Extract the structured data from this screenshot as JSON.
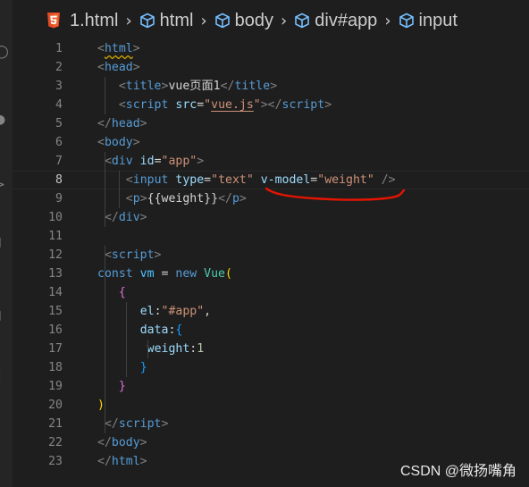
{
  "breadcrumb": {
    "file": "1.html",
    "items": [
      "html",
      "body",
      "div#app",
      "input"
    ]
  },
  "lines": [
    {
      "n": "1",
      "tokens": [
        [
          "bracket",
          "<"
        ],
        [
          "tag-squig",
          "html"
        ],
        [
          "bracket",
          ">"
        ]
      ]
    },
    {
      "n": "2",
      "tokens": [
        [
          "bracket",
          "<"
        ],
        [
          "tag",
          "head"
        ],
        [
          "bracket",
          ">"
        ]
      ]
    },
    {
      "n": "3",
      "tokens": [
        [
          "bracket",
          "<"
        ],
        [
          "tag",
          "title"
        ],
        [
          "bracket",
          ">"
        ],
        [
          "text",
          "vue页面1"
        ],
        [
          "bracket",
          "</"
        ],
        [
          "tag",
          "title"
        ],
        [
          "bracket",
          ">"
        ]
      ]
    },
    {
      "n": "4",
      "tokens": [
        [
          "bracket",
          "<"
        ],
        [
          "tag",
          "script"
        ],
        [
          "text",
          " "
        ],
        [
          "attr",
          "src"
        ],
        [
          "text",
          "="
        ],
        [
          "str",
          "\""
        ],
        [
          "str-ul",
          "vue.js"
        ],
        [
          "str",
          "\""
        ],
        [
          "bracket",
          "></"
        ],
        [
          "tag",
          "script"
        ],
        [
          "bracket",
          ">"
        ]
      ]
    },
    {
      "n": "5",
      "tokens": [
        [
          "bracket",
          "</"
        ],
        [
          "tag",
          "head"
        ],
        [
          "bracket",
          ">"
        ]
      ]
    },
    {
      "n": "6",
      "tokens": [
        [
          "bracket",
          "<"
        ],
        [
          "tag",
          "body"
        ],
        [
          "bracket",
          ">"
        ]
      ]
    },
    {
      "n": "7",
      "tokens": [
        [
          "bracket",
          "<"
        ],
        [
          "tag",
          "div"
        ],
        [
          "text",
          " "
        ],
        [
          "attr",
          "id"
        ],
        [
          "text",
          "="
        ],
        [
          "str",
          "\"app\""
        ],
        [
          "bracket",
          ">"
        ]
      ]
    },
    {
      "n": "8",
      "tokens": [
        [
          "bracket",
          "<"
        ],
        [
          "tag",
          "input"
        ],
        [
          "text",
          " "
        ],
        [
          "attr",
          "type"
        ],
        [
          "text",
          "="
        ],
        [
          "str",
          "\"text\""
        ],
        [
          "text",
          " "
        ],
        [
          "attr",
          "v-model"
        ],
        [
          "text",
          "="
        ],
        [
          "str",
          "\"weight\""
        ],
        [
          "text",
          " "
        ],
        [
          "bracket",
          "/>"
        ]
      ]
    },
    {
      "n": "9",
      "tokens": [
        [
          "bracket",
          "<"
        ],
        [
          "tag",
          "p"
        ],
        [
          "bracket",
          ">"
        ],
        [
          "text",
          "{{weight}}"
        ],
        [
          "bracket",
          "</"
        ],
        [
          "tag",
          "p"
        ],
        [
          "bracket",
          ">"
        ]
      ]
    },
    {
      "n": "10",
      "tokens": [
        [
          "bracket",
          "</"
        ],
        [
          "tag",
          "div"
        ],
        [
          "bracket",
          ">"
        ]
      ]
    },
    {
      "n": "11",
      "tokens": []
    },
    {
      "n": "12",
      "tokens": [
        [
          "bracket",
          "<"
        ],
        [
          "tag",
          "script"
        ],
        [
          "bracket",
          ">"
        ]
      ]
    },
    {
      "n": "13",
      "tokens": [
        [
          "kw",
          "const"
        ],
        [
          "text",
          " "
        ],
        [
          "var",
          "vm"
        ],
        [
          "text",
          " = "
        ],
        [
          "kw",
          "new"
        ],
        [
          "text",
          " "
        ],
        [
          "cls",
          "Vue"
        ],
        [
          "paren",
          "("
        ]
      ]
    },
    {
      "n": "14",
      "tokens": [
        [
          "brace2",
          "{"
        ]
      ]
    },
    {
      "n": "15",
      "tokens": [
        [
          "attr",
          "el"
        ],
        [
          "text",
          ":"
        ],
        [
          "str",
          "\"#app\""
        ],
        [
          "text",
          ","
        ]
      ]
    },
    {
      "n": "16",
      "tokens": [
        [
          "attr",
          "data"
        ],
        [
          "text",
          ":"
        ],
        [
          "brace3",
          "{"
        ]
      ]
    },
    {
      "n": "17",
      "tokens": [
        [
          "attr",
          "weight"
        ],
        [
          "text",
          ":"
        ],
        [
          "num",
          "1"
        ]
      ]
    },
    {
      "n": "18",
      "tokens": [
        [
          "brace3",
          "}"
        ]
      ]
    },
    {
      "n": "19",
      "tokens": [
        [
          "brace2",
          "}"
        ]
      ]
    },
    {
      "n": "20",
      "tokens": [
        [
          "paren",
          ")"
        ]
      ]
    },
    {
      "n": "21",
      "tokens": [
        [
          "bracket",
          "</"
        ],
        [
          "tag",
          "script"
        ],
        [
          "bracket",
          ">"
        ]
      ]
    },
    {
      "n": "22",
      "tokens": [
        [
          "bracket",
          "</"
        ],
        [
          "tag",
          "body"
        ],
        [
          "bracket",
          ">"
        ]
      ]
    },
    {
      "n": "23",
      "tokens": [
        [
          "bracket",
          "</"
        ],
        [
          "tag",
          "html"
        ],
        [
          "bracket",
          ">"
        ]
      ]
    }
  ],
  "active_line": "8",
  "watermark": "CSDN @微扬嘴角",
  "colors": {
    "background": "#1e1e1e",
    "annotation": "#e51400"
  }
}
